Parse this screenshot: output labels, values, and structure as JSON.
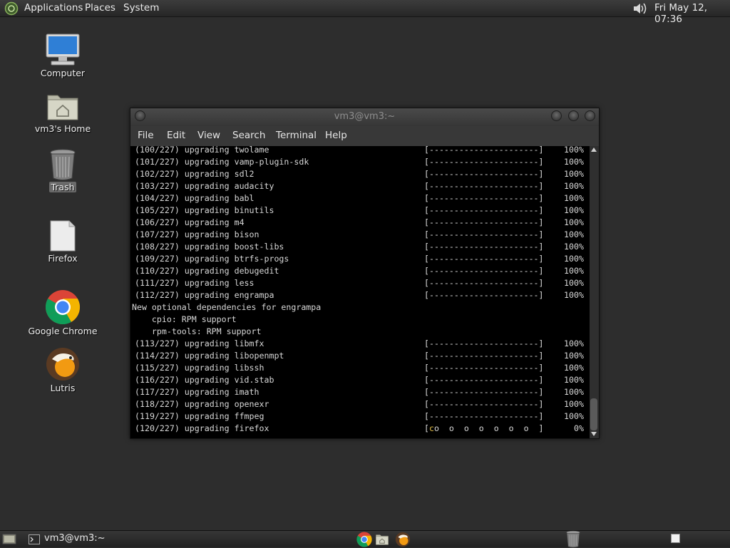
{
  "top_panel": {
    "menus": [
      "Applications",
      "Places",
      "System"
    ],
    "clock": "Fri May 12, 07:36"
  },
  "desktop_icons": [
    "Computer",
    "vm3's Home",
    "Trash",
    "Firefox",
    "Google Chrome",
    "Lutris"
  ],
  "terminal": {
    "title": "vm3@vm3:~",
    "menu": [
      "File",
      "Edit",
      "View",
      "Search",
      "Terminal",
      "Help"
    ],
    "progress_bar": "[----------------------]",
    "lines": [
      {
        "pkg": "(100/227) upgrading twolame",
        "pct": "100%"
      },
      {
        "pkg": "(101/227) upgrading vamp-plugin-sdk",
        "pct": "100%"
      },
      {
        "pkg": "(102/227) upgrading sdl2",
        "pct": "100%"
      },
      {
        "pkg": "(103/227) upgrading audacity",
        "pct": "100%"
      },
      {
        "pkg": "(104/227) upgrading babl",
        "pct": "100%"
      },
      {
        "pkg": "(105/227) upgrading binutils",
        "pct": "100%"
      },
      {
        "pkg": "(106/227) upgrading m4",
        "pct": "100%"
      },
      {
        "pkg": "(107/227) upgrading bison",
        "pct": "100%"
      },
      {
        "pkg": "(108/227) upgrading boost-libs",
        "pct": "100%"
      },
      {
        "pkg": "(109/227) upgrading btrfs-progs",
        "pct": "100%"
      },
      {
        "pkg": "(110/227) upgrading debugedit",
        "pct": "100%"
      },
      {
        "pkg": "(111/227) upgrading less",
        "pct": "100%"
      },
      {
        "pkg": "(112/227) upgrading engrampa",
        "pct": "100%"
      },
      {
        "text": "New optional dependencies for engrampa"
      },
      {
        "text": "    cpio: RPM support"
      },
      {
        "text": "    rpm-tools: RPM support"
      },
      {
        "pkg": "(113/227) upgrading libmfx",
        "pct": "100%"
      },
      {
        "pkg": "(114/227) upgrading libopenmpt",
        "pct": "100%"
      },
      {
        "pkg": "(115/227) upgrading libssh",
        "pct": "100%"
      },
      {
        "pkg": "(116/227) upgrading vid.stab",
        "pct": "100%"
      },
      {
        "pkg": "(117/227) upgrading imath",
        "pct": "100%"
      },
      {
        "pkg": "(118/227) upgrading openexr",
        "pct": "100%"
      },
      {
        "pkg": "(119/227) upgrading ffmpeg",
        "pct": "100%"
      },
      {
        "pkg": "(120/227) upgrading firefox",
        "pct": "0%",
        "bar_active": true
      }
    ],
    "active_bar": {
      "start": "[",
      "cursor": "c",
      "dots": "o  o  o  o  o  o  o",
      "end": "]"
    }
  },
  "bottom_panel": {
    "task_label": "vm3@vm3:~"
  },
  "colors": {
    "desktop_bg": "#2d2d2d",
    "terminal_bg": "#000000",
    "terminal_fg": "#d8d8d8",
    "pacman_cursor": "#e9c44a"
  }
}
